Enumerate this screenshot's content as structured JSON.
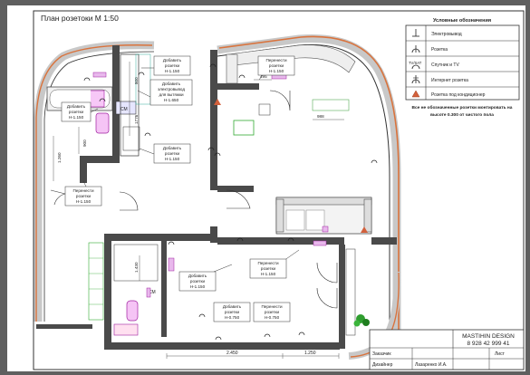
{
  "sheet_title": "План розетоки М 1:50",
  "legend": {
    "title": "Условные обозначения",
    "items": [
      {
        "label": "Электровывод",
        "icon": "electrical-outlet-point-icon"
      },
      {
        "label": "Розетка",
        "icon": "socket-icon"
      },
      {
        "symbol": "TV/SAT",
        "label": "Спутник и TV",
        "icon": "tv-socket-icon"
      },
      {
        "label": "Интернет розетка",
        "icon": "internet-socket-icon"
      },
      {
        "label": "Розетка под кондиционер",
        "icon": "ac-socket-icon"
      }
    ],
    "note": [
      "Все не обозначенные розетки монтировать на",
      "высоте 0.300 от чистого пола"
    ]
  },
  "annotations": {
    "a1": [
      "Добавить",
      "розетки",
      "Н-1.150"
    ],
    "a2": [
      "Добавить",
      "электровывод",
      "для вытяжки",
      "Н-1.650"
    ],
    "a3": [
      "Добавить",
      "розетки",
      "Н-1.150"
    ],
    "a4": [
      "Добавить",
      "розетки",
      "Н-1.150"
    ],
    "a5": [
      "Перенести",
      "розетки",
      "Н-1.150"
    ],
    "a6": [
      "Перенести",
      "розетки",
      "Н-1.150"
    ],
    "a7": [
      "Перенести",
      "розетки",
      "Н-1.150"
    ],
    "a8": [
      "Добавить",
      "розетки",
      "Н-1.150"
    ],
    "a9": [
      "Добавить",
      "розетки",
      "Н-0.750"
    ],
    "a10": [
      "Перенести",
      "розетки",
      "Н-0.750"
    ]
  },
  "dimensions": {
    "d_800": "800",
    "d_1776": "1776",
    "d_900": "900",
    "d_1260": "1.260",
    "d_495": "495",
    "d_988": "988",
    "d_1430": "1.430",
    "d_2450": "2.450",
    "d_1250": "1.250"
  },
  "fixture_labels": {
    "cm": "СМ",
    "ss": "СМ"
  },
  "title_block": {
    "company": "MASTIHIN DESIGN",
    "phone": "8 928 42 999 41",
    "customer_label": "Заказчик",
    "designer_label": "Дизайнер",
    "designer_name": "Лазаренко И.А.",
    "sheet_label": "Лист"
  }
}
